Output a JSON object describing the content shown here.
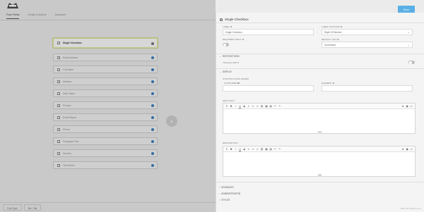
{
  "builder": {
    "tabs": [
      "Form Fields",
      "Emails & Actions",
      "Advanced"
    ],
    "fields": [
      {
        "label": "Single Checkbox",
        "selected": true
      },
      {
        "label": "Email Address"
      },
      {
        "label": "Full Name"
      },
      {
        "label": "Address"
      },
      {
        "label": "Date Picker"
      },
      {
        "label": "Product"
      },
      {
        "label": "Email Report"
      },
      {
        "label": "Phone"
      },
      {
        "label": "Paragraph Text"
      },
      {
        "label": "Number"
      },
      {
        "label": "Text Button"
      }
    ],
    "footer_buttons": [
      "Font Type",
      "Bin / Tab"
    ]
  },
  "drawer": {
    "done_label": "Done",
    "title": "Single Checkbox",
    "label_label": "LABEL",
    "label_value": "Single Checkbox",
    "label_position_label": "LABEL POSITION",
    "label_position_value": "Right Of Element",
    "required_label": "REQUIRED FIELD",
    "default_value_label": "DEFAULT VALUE",
    "default_value_value": "Unchecked",
    "restrictions_label": "RESTRICTIONS",
    "toggle_label": "TOGGLE INPUT",
    "display_label": "DISPLAY",
    "custom_classes_label": "CUSTOM CLASS NAMES",
    "container_label": "CONTAINER",
    "element_label": "ELEMENT",
    "help_text_label": "HELP TEXT",
    "description_label": "DESCRIPTION",
    "advanced_label": "ADVANCED",
    "administration_label": "ADMINISTRATION",
    "styles_label": "STYLES"
  },
  "editor_toolbar": [
    "¶",
    "B",
    "I",
    "U",
    "S",
    "≡",
    "≡",
    "≡",
    "⛓",
    "▦",
    "▤",
    "↶",
    "↷"
  ],
  "editor_toolbar_right": [
    "⧉",
    "▣",
    "<>"
  ],
  "watermark": "Built with Ninja Forms"
}
